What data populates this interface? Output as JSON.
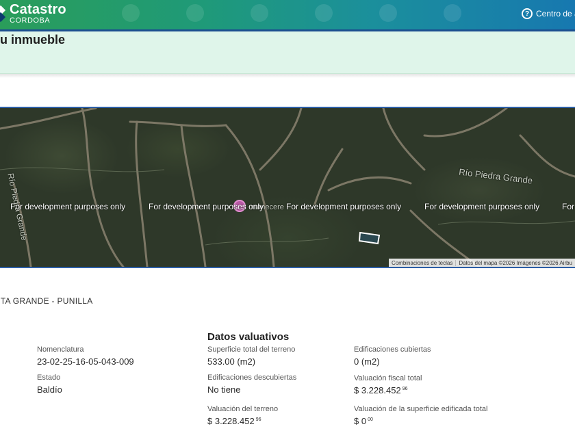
{
  "header": {
    "brand_title": "Catastro",
    "brand_subtitle": "CORDOBA",
    "help_label": "Centro de a"
  },
  "page": {
    "title": "tu inmueble",
    "location": "RTA GRANDE - PUNILLA"
  },
  "map": {
    "watermark": "For development purposes only",
    "watermark_partial": "For",
    "labels": {
      "river_right": "Río Piedra Grande",
      "river_left": "Río Piedra Grande",
      "road": "manecere"
    },
    "attribution": {
      "shortcuts": "Combinaciones de teclas",
      "data": "Datos del mapa ©2026 Imágenes ©2026 Airbu"
    }
  },
  "datos": {
    "section_title": "Datos valuativos",
    "nomenclatura": {
      "label": "Nomenclatura",
      "value": "23-02-25-16-05-043-009"
    },
    "estado": {
      "label": "Estado",
      "value": "Baldío"
    },
    "superficie_terreno": {
      "label": "Superficie total del terreno",
      "value": "533.00 (m2)"
    },
    "edif_descubiertas": {
      "label": "Edificaciones descubiertas",
      "value": "No tiene"
    },
    "valuacion_terreno": {
      "label": "Valuación del terreno",
      "value": "$ 3.228.452",
      "cents": "96"
    },
    "edif_cubiertas": {
      "label": "Edificaciones cubiertas",
      "value": "0 (m2)"
    },
    "valuacion_fiscal": {
      "label": "Valuación fiscal total",
      "value": "$ 3.228.452",
      "cents": "96"
    },
    "valuacion_edificada": {
      "label": "Valuación de la superficie edificada total",
      "value": "$ 0",
      "cents": "00"
    }
  },
  "colors": {
    "header_start": "#2a9d5a",
    "header_end": "#1778b0",
    "title_band": "#dff5ea",
    "map_border": "#2c5ea6",
    "parcel_outline": "#ffffff",
    "marker": "#d44fb0"
  },
  "icons": {
    "brand": "catastro-logo-icon",
    "help": "help-circle-icon",
    "marker": "location-marker-icon"
  }
}
